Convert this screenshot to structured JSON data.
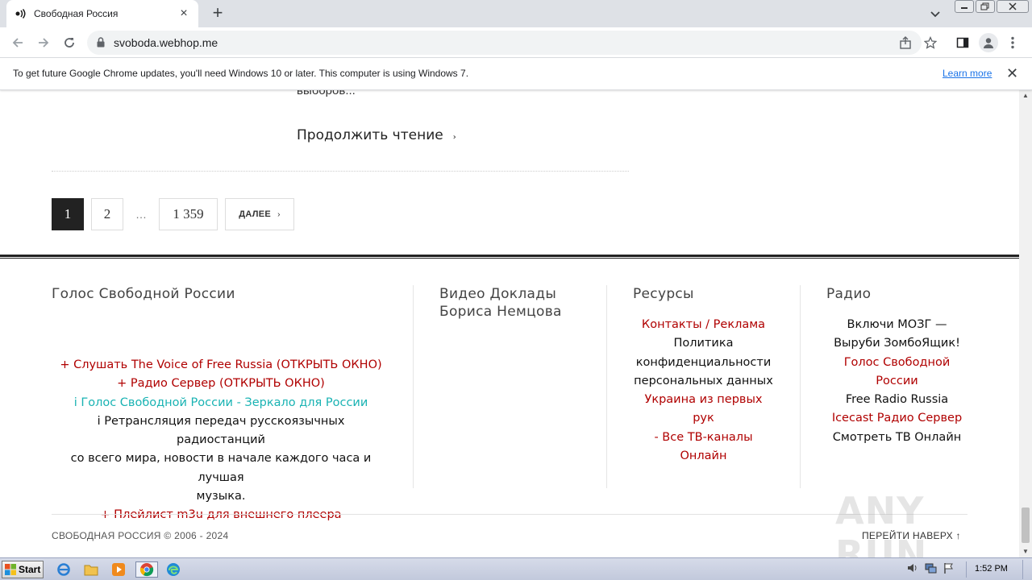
{
  "browser": {
    "tab": {
      "title": "Свободная Россия",
      "favicon": "speaker-wave-icon"
    },
    "url": "svoboda.webhop.me",
    "infobar": {
      "message": "To get future Google Chrome updates, you'll need Windows 10 or later. This computer is using Windows 7.",
      "link": "Learn more"
    }
  },
  "article": {
    "cut_text": "выборов...",
    "continue_label": "Продолжить чтение",
    "continue_chevron": "›"
  },
  "pagination": {
    "pages": [
      "1",
      "2"
    ],
    "ellipsis": "…",
    "last_page": "1 359",
    "next_label": "ДАЛЕЕ",
    "next_chevron": "›",
    "active": "1"
  },
  "footer": {
    "col1": {
      "title": "Голос Свободной России",
      "lines": [
        "+ Слушать The Voice of Free Russia (ОТКРЫТЬ ОКНО)",
        "+ Радио Сервер (ОТКРЫТЬ ОКНО)",
        "i Голос Свободной России - Зеркало для России",
        "i Ретрансляция передач русскоязычных радиостанций",
        "со всего мира, новости в начале каждого часа и лучшая",
        "музыка.",
        "+ Плейлист m3u для внешнего плеера"
      ]
    },
    "col2": {
      "title_line1": "Видео Доклады",
      "title_line2": "Бориса Немцова"
    },
    "col3": {
      "title": "Ресурсы",
      "lines": [
        "Контакты / Реклама",
        "Политика",
        "конфиденциальности",
        "персональных данных",
        "Украина из первых рук",
        "- Все ТВ-каналы",
        "Онлайн"
      ]
    },
    "col4": {
      "title": "Радио",
      "lines": [
        "Включи МОЗГ —",
        "Выруби ЗомбоЯщик!",
        "Голос Свободной",
        "России",
        "Free Radio Russia",
        "Icecast Радио Сервер",
        "Смотреть ТВ Онлайн"
      ]
    },
    "copyright": "СВОБОДНАЯ РОССИЯ © 2006 - 2024",
    "back_to_top": "ПЕРЕЙТИ НАВЕРХ ↑"
  },
  "watermark": "ANY RUN",
  "taskbar": {
    "start_label": "Start",
    "clock": "1:52 PM"
  },
  "colors": {
    "link_red": "#b00000",
    "link_teal": "#19b3b3",
    "active_page": "#222222",
    "chrome_frame": "#dee1e6"
  }
}
